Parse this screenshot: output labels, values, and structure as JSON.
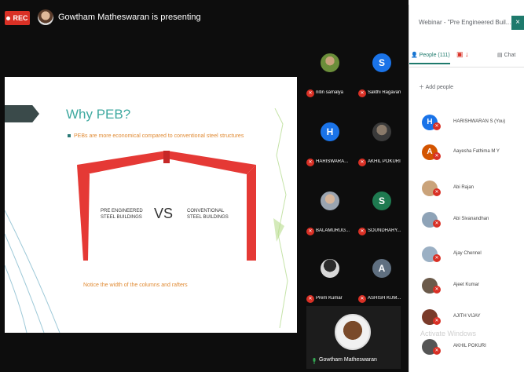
{
  "recording": {
    "label": "REC"
  },
  "presenter_banner": {
    "text": "Gowtham Matheswaran is presenting"
  },
  "slide": {
    "title": "Why PEB?",
    "bullet": "PEBs are more economical compared to conventional steel structures",
    "left_label_1": "PRE ENGINEERED",
    "left_label_2": "STEEL BUILDINGS",
    "vs": "VS",
    "right_label_1": "CONVENTIONAL",
    "right_label_2": "STEEL BUILDINGS",
    "caption": "Notice the width of the columns and rafters"
  },
  "tiles": [
    {
      "name": "nitin samalya",
      "initial": "",
      "color": "#6b8e3a"
    },
    {
      "name": "Sakthi Ragavan",
      "initial": "S",
      "color": "#1a73e8"
    },
    {
      "name": "HARISWARA...",
      "initial": "H",
      "color": "#1a73e8"
    },
    {
      "name": "AKHIL POKURI",
      "initial": "",
      "color": "#555555"
    },
    {
      "name": "BALAMURUG...",
      "initial": "",
      "color": "#9aa4b0"
    },
    {
      "name": "SOUNDHARY...",
      "initial": "S",
      "color": "#1e7a50"
    },
    {
      "name": "Prem Kumar",
      "initial": "",
      "color": "#2b2b2b"
    },
    {
      "name": "ASHISH KUM...",
      "initial": "A",
      "color": "#5f6f80"
    }
  ],
  "self_view": {
    "name": "Gowtham Matheswaran"
  },
  "sidebar": {
    "title": "Webinar - \"Pre Engineered Buil...",
    "tab_people": "People (111)",
    "tab_chat": "Chat",
    "add_people": "Add people",
    "people": [
      {
        "name": "HARISHWARAN S (You)",
        "initial": "H",
        "color": "#1a73e8"
      },
      {
        "name": "Aayesha Fathima M Y",
        "initial": "A",
        "color": "#d35400"
      },
      {
        "name": "Abi Rajan",
        "initial": "",
        "color": "#caa37a"
      },
      {
        "name": "Abi Sivanandhan",
        "initial": "",
        "color": "#8ea3b7"
      },
      {
        "name": "Ajay Chennel",
        "initial": "",
        "color": "#9bb0c4"
      },
      {
        "name": "Ajeet Kumar",
        "initial": "",
        "color": "#6b5a4a"
      },
      {
        "name": "AJITH VIJAY",
        "initial": "",
        "color": "#7a3b2a"
      },
      {
        "name": "AKHIL POKURI",
        "initial": "",
        "color": "#555555"
      }
    ],
    "watermark": "Activate Windows"
  }
}
